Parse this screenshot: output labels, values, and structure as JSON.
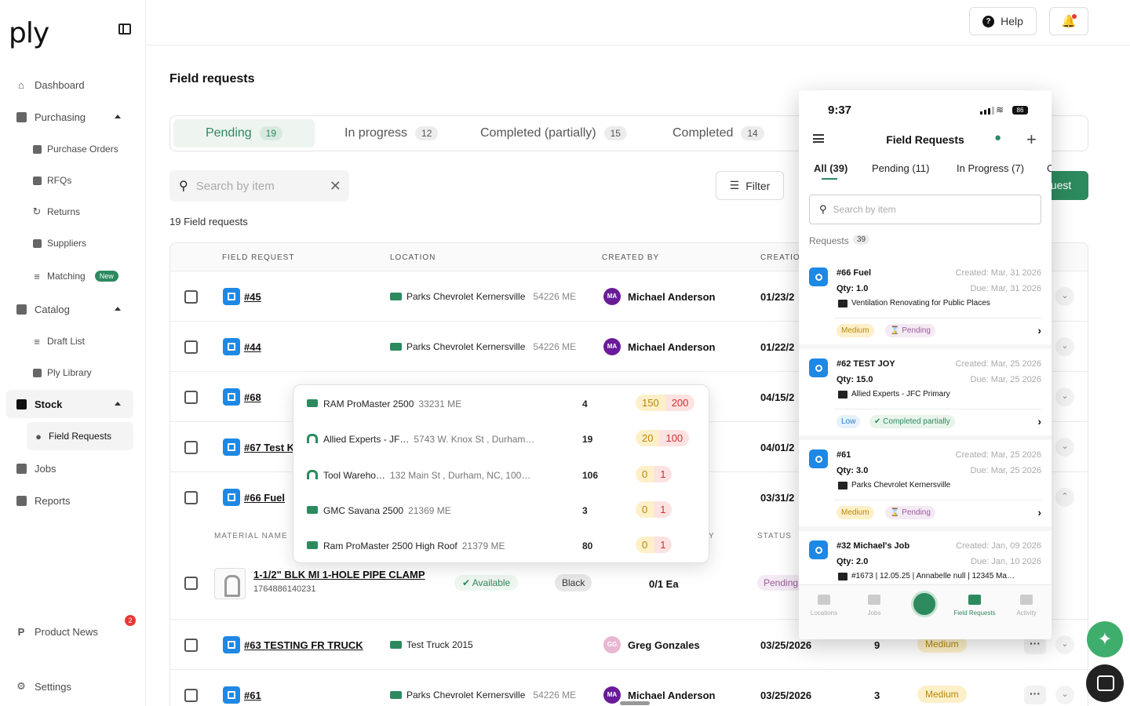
{
  "app": {
    "logo": "ply"
  },
  "sidebar": {
    "items": [
      {
        "label": "Dashboard"
      },
      {
        "label": "Purchasing"
      },
      {
        "label": "Purchase Orders"
      },
      {
        "label": "RFQs"
      },
      {
        "label": "Returns"
      },
      {
        "label": "Suppliers"
      },
      {
        "label": "Matching",
        "badge": "New"
      },
      {
        "label": "Catalog"
      },
      {
        "label": "Draft List"
      },
      {
        "label": "Ply Library"
      },
      {
        "label": "Stock"
      },
      {
        "label": "Field Requests"
      },
      {
        "label": "Jobs"
      },
      {
        "label": "Reports"
      },
      {
        "label": "Product News",
        "badge": "2"
      },
      {
        "label": "Settings"
      }
    ]
  },
  "topbar": {
    "help_label": "Help"
  },
  "page": {
    "title": "Field requests",
    "count_label": "19 Field requests"
  },
  "tabs": [
    {
      "label": "Pending",
      "count": "19"
    },
    {
      "label": "In progress",
      "count": "12"
    },
    {
      "label": "Completed (partially)",
      "count": "15"
    },
    {
      "label": "Completed",
      "count": "14"
    }
  ],
  "search": {
    "placeholder": "Search by item"
  },
  "filter_label": "Filter",
  "create_label_visible": "quest",
  "table": {
    "headers": [
      "FIELD REQUEST",
      "LOCATION",
      "CREATED BY",
      "CREATIO"
    ],
    "rows": [
      {
        "id": "#45",
        "location": "Parks Chevrolet Kernersville",
        "loc_sub": "54226 ME",
        "initials": "MA",
        "creator": "Michael Anderson",
        "date": "01/23/2"
      },
      {
        "id": "#44",
        "location": "Parks Chevrolet Kernersville",
        "loc_sub": "54226 ME",
        "initials": "MA",
        "creator": "Michael Anderson",
        "date": "01/22/2"
      },
      {
        "id": "#68",
        "date": "04/15/2"
      },
      {
        "id": "#67 Test Ki",
        "date": "04/01/2"
      },
      {
        "id": "#66 Fuel",
        "date": "03/31/2"
      },
      {
        "id": "#63 TESTING FR TRUCK",
        "location": "Test Truck 2015",
        "loc_sub": "",
        "initials": "GG",
        "creator": "Greg Gonzales",
        "date": "03/25/2026",
        "qty": "9",
        "priority": "Medium"
      },
      {
        "id": "#61",
        "location": "Parks Chevrolet Kernersville",
        "loc_sub": "54226 ME",
        "initials": "MA",
        "creator": "Michael Anderson",
        "date": "03/25/2026",
        "qty": "3",
        "priority": "Medium"
      }
    ],
    "material_headers": [
      "MATERIAL NAME",
      "Y",
      "STATUS"
    ],
    "material": {
      "name": "1-1/2\" BLK MI 1-HOLE PIPE CLAMP",
      "code": "1764886140231",
      "availability": "Available",
      "color": "Black",
      "qty": "0/1 Ea",
      "status": "Pending"
    }
  },
  "popover": {
    "rows": [
      {
        "name": "RAM ProMaster 2500",
        "sub": "33231 ME",
        "num": "4",
        "a": "150",
        "b": "200",
        "type": "truck"
      },
      {
        "name": "Allied Experts - JF…",
        "sub": "5743 W. Knox St , Durham…",
        "num": "19",
        "a": "20",
        "b": "100",
        "type": "warehouse"
      },
      {
        "name": "Tool Wareho…",
        "sub": "132 Main St , Durham, NC, 100…",
        "num": "106",
        "a": "0",
        "b": "1",
        "type": "warehouse"
      },
      {
        "name": "GMC Savana 2500",
        "sub": "21369 ME",
        "num": "3",
        "a": "0",
        "b": "1",
        "type": "truck"
      },
      {
        "name": "Ram ProMaster 2500 High Roof",
        "sub": "21379 ME",
        "num": "80",
        "a": "0",
        "b": "1",
        "type": "truck"
      }
    ]
  },
  "phone": {
    "time": "9:37",
    "battery": "86",
    "title": "Field Requests",
    "tabs": [
      "All (39)",
      "Pending (11)",
      "In Progress (7)",
      "C"
    ],
    "search_placeholder": "Search by item",
    "requests_label": "Requests",
    "requests_count": "39",
    "cards": [
      {
        "title": "#66 Fuel",
        "qty": "Qty: 1.0",
        "created": "Created: Mar, 31 2026",
        "due": "Due: Mar, 31 2026",
        "location": "Ventilation Renovating for Public Places",
        "prio": "Medium",
        "status": "Pending"
      },
      {
        "title": "#62 TEST JOY",
        "qty": "Qty: 15.0",
        "created": "Created: Mar, 25 2026",
        "due": "Due: Mar, 25 2026",
        "location": "Allied Experts - JFC Primary",
        "prio": "Low",
        "status": "Completed partially"
      },
      {
        "title": "#61",
        "qty": "Qty: 3.0",
        "created": "Created: Mar, 25 2026",
        "due": "Due: Mar, 25 2026",
        "location": "Parks Chevrolet Kernersville",
        "prio": "Medium",
        "status": "Pending"
      },
      {
        "title": "#32 Michael's Job",
        "qty": "Qty: 2.0",
        "created": "Created: Jan, 09 2026",
        "due": "Due: Jan, 10 2026",
        "location": "#1673 | 12.05.25 | Annabelle null | 12345 Ma…"
      }
    ],
    "nav": [
      "Locations",
      "Jobs",
      "Field Requests",
      "Activity"
    ]
  }
}
